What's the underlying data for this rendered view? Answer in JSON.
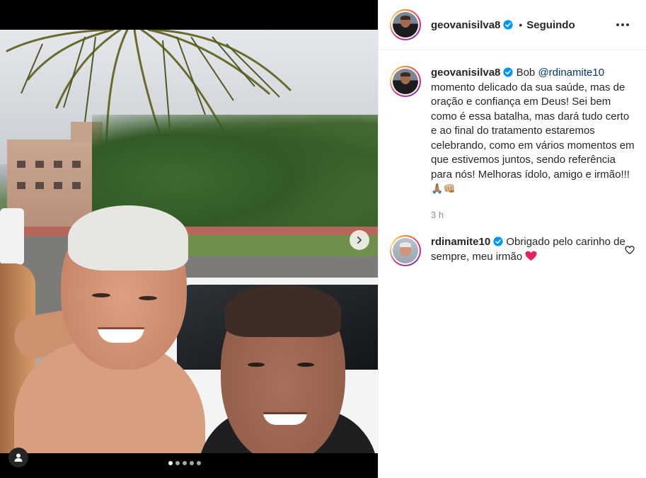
{
  "post": {
    "media": {
      "carousel_count": 5,
      "active_index": 0
    },
    "author": {
      "username": "geovanisilva8",
      "verified": true,
      "follow_status": "Seguindo"
    },
    "caption": {
      "username": "geovanisilva8",
      "prefix": "Bob",
      "mention": "@rdinamite10",
      "text": "momento delicado da sua saúde, mas de oração e confiança em Deus! Sei bem como é essa batalha, mas dará tudo certo e ao final do tratamento estaremos celebrando, como em vários momentos em que estivemos juntos, sendo referência para nós! Melhoras ídolo, amigo e irmão!!!",
      "emojis": "🙏🏽👊🏼",
      "time": "3 h"
    },
    "comments": [
      {
        "username": "rdinamite10",
        "verified": true,
        "text": "Obrigado pelo carinho de sempre, meu irmão"
      }
    ]
  },
  "colors": {
    "text": "#262626",
    "muted": "#8e8e8e",
    "mention": "#00376b",
    "verified": "#0095f6",
    "heart": "#ed4956",
    "border": "#efefef"
  },
  "icons": {
    "verified": "verified-badge-icon",
    "more": "more-options-icon",
    "next": "chevron-right-icon",
    "user_tag": "user-tag-icon",
    "like": "heart-outline-icon"
  }
}
